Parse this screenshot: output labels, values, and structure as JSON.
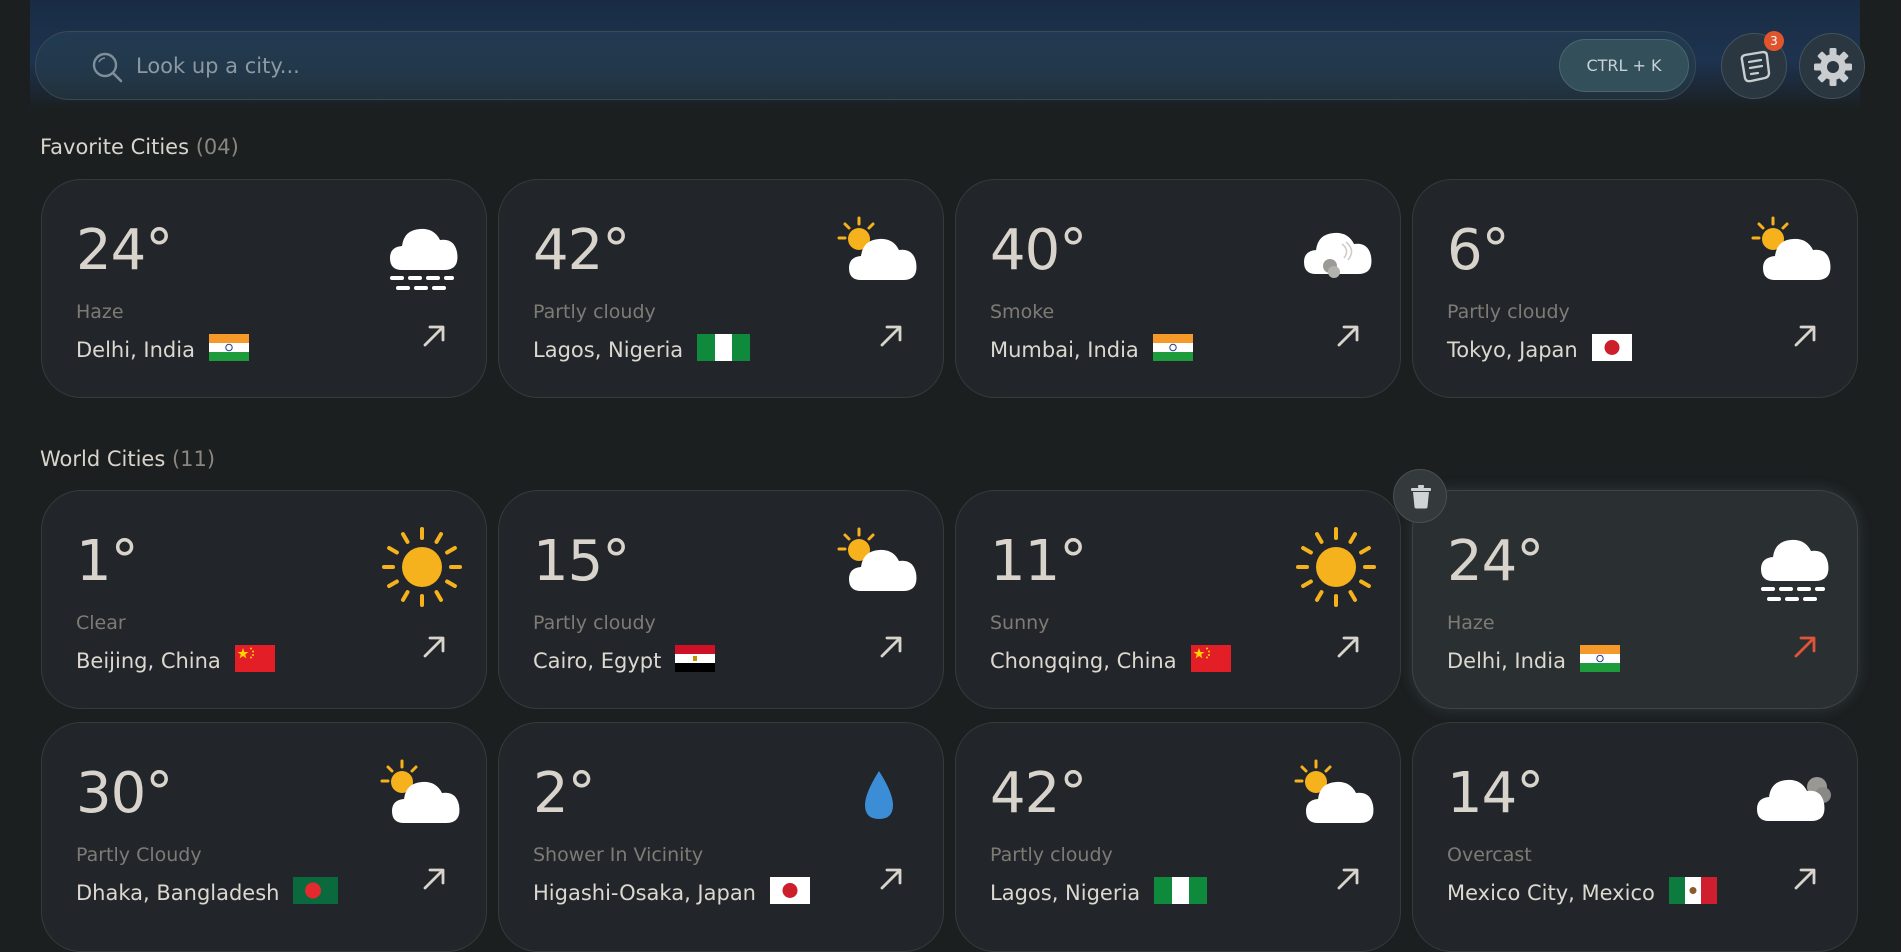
{
  "search": {
    "placeholder": "Look up a city...",
    "shortcut": "CTRL + K",
    "search_icon": "search-icon"
  },
  "header_buttons": {
    "notes_icon": "notes-icon",
    "notes_badge": "3",
    "settings_icon": "gear-icon"
  },
  "favorites": {
    "title": "Favorite Cities",
    "count": "(04)",
    "cards": [
      {
        "temp": "24°",
        "condition": "Haze",
        "location": "Delhi, India",
        "flag": "india",
        "icon": "haze"
      },
      {
        "temp": "42°",
        "condition": "Partly cloudy",
        "location": "Lagos, Nigeria",
        "flag": "nigeria",
        "icon": "partly-cloudy"
      },
      {
        "temp": "40°",
        "condition": "Smoke",
        "location": "Mumbai, India",
        "flag": "india",
        "icon": "smoke"
      },
      {
        "temp": "6°",
        "condition": "Partly cloudy",
        "location": "Tokyo, Japan",
        "flag": "japan",
        "icon": "partly-cloudy"
      }
    ]
  },
  "world": {
    "title": "World Cities",
    "count": "(11)",
    "cards": [
      {
        "temp": "1°",
        "condition": "Clear",
        "location": "Beijing, China",
        "flag": "china",
        "icon": "sun"
      },
      {
        "temp": "15°",
        "condition": "Partly cloudy",
        "location": "Cairo, Egypt",
        "flag": "egypt",
        "icon": "partly-cloudy"
      },
      {
        "temp": "11°",
        "condition": "Sunny",
        "location": "Chongqing, China",
        "flag": "china",
        "icon": "sun"
      },
      {
        "temp": "24°",
        "condition": "Haze",
        "location": "Delhi, India",
        "flag": "india",
        "icon": "haze"
      },
      {
        "temp": "30°",
        "condition": "Partly Cloudy",
        "location": "Dhaka, Bangladesh",
        "flag": "bangladesh",
        "icon": "partly-cloudy"
      },
      {
        "temp": "2°",
        "condition": "Shower In Vicinity",
        "location": "Higashi-Osaka, Japan",
        "flag": "japan",
        "icon": "drop"
      },
      {
        "temp": "42°",
        "condition": "Partly cloudy",
        "location": "Lagos, Nigeria",
        "flag": "nigeria",
        "icon": "partly-cloudy"
      },
      {
        "temp": "14°",
        "condition": "Overcast",
        "location": "Mexico City, Mexico",
        "flag": "mexico",
        "icon": "overcast"
      }
    ]
  },
  "colors": {
    "accent_hover_arrow": "#e0553a",
    "sun": "#f6b21c",
    "drop": "#3b8ed6",
    "badge": "#e0552d"
  }
}
